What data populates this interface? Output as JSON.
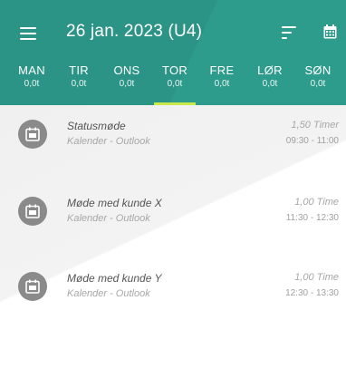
{
  "header": {
    "title": "26 jan. 2023 (U4)",
    "menu_icon": "menu-icon",
    "sort_icon": "sort-icon",
    "calendar_icon": "calendar-icon",
    "background": "#2e9c8d",
    "selected_indicator": "#c9e84a"
  },
  "days": [
    {
      "name": "MAN",
      "value": "0,0t",
      "selected": false
    },
    {
      "name": "TIR",
      "value": "0,0t",
      "selected": false
    },
    {
      "name": "ONS",
      "value": "0,0t",
      "selected": false
    },
    {
      "name": "TOR",
      "value": "0,0t",
      "selected": true
    },
    {
      "name": "FRE",
      "value": "0,0t",
      "selected": false
    },
    {
      "name": "LØR",
      "value": "0,0t",
      "selected": false
    },
    {
      "name": "SØN",
      "value": "0,0t",
      "selected": false
    }
  ],
  "entries": [
    {
      "title": "Statusmøde",
      "subtitle": "Kalender - Outlook",
      "hours": "1,50 Timer",
      "time": "09:30 - 11:00",
      "icon": "calendar-icon"
    },
    {
      "title": "Møde med kunde X",
      "subtitle": "Kalender - Outlook",
      "hours": "1,00 Time",
      "time": "11:30 - 12:30",
      "icon": "calendar-icon"
    },
    {
      "title": "Møde med kunde Y",
      "subtitle": "Kalender - Outlook",
      "hours": "1,00 Time",
      "time": "12:30 - 13:30",
      "icon": "calendar-icon"
    }
  ]
}
